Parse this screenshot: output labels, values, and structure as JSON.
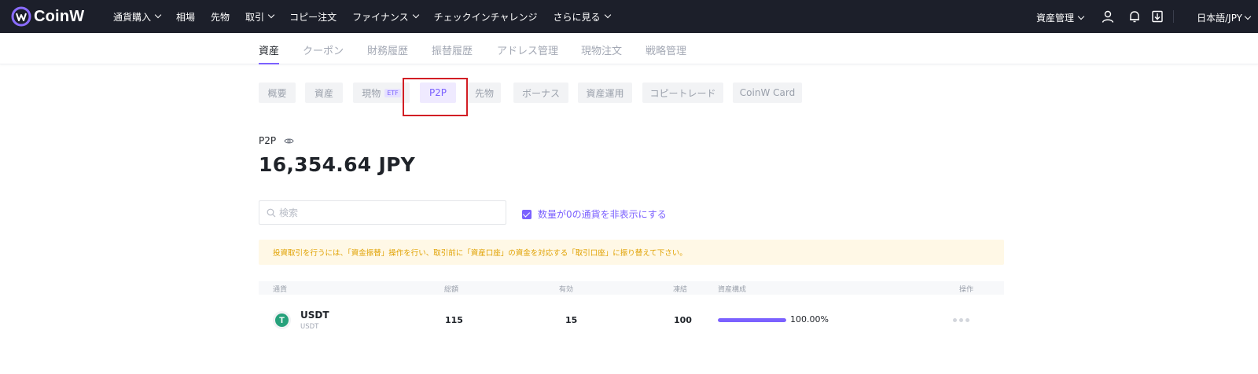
{
  "brand": {
    "name": "CoinW",
    "accent": "#7b61ff",
    "nav_bg": "#1c1f2a"
  },
  "topnav": {
    "items": [
      {
        "label": "通貨購入",
        "dropdown": true
      },
      {
        "label": "相場",
        "dropdown": false
      },
      {
        "label": "先物",
        "dropdown": false
      },
      {
        "label": "取引",
        "dropdown": true
      },
      {
        "label": "コピー注文",
        "dropdown": false
      },
      {
        "label": "ファイナンス",
        "dropdown": true
      },
      {
        "label": "チェックインチャレンジ",
        "dropdown": false
      },
      {
        "label": "さらに見る",
        "dropdown": true
      }
    ],
    "asset_management": "資産管理",
    "language": "日本語/JPY",
    "icons": [
      "user-icon",
      "bell-icon",
      "download-icon"
    ]
  },
  "subtabs": [
    {
      "label": "資産",
      "active": true
    },
    {
      "label": "クーポン",
      "active": false
    },
    {
      "label": "財務履歴",
      "active": false
    },
    {
      "label": "振替履歴",
      "active": false
    },
    {
      "label": "アドレス管理",
      "active": false
    },
    {
      "label": "現物注文",
      "active": false
    },
    {
      "label": "戦略管理",
      "active": false
    }
  ],
  "categories": [
    {
      "label": "概要"
    },
    {
      "label": "資産"
    },
    {
      "label": "現物",
      "badge": "ETF"
    },
    {
      "label": "P2P",
      "active": true
    },
    {
      "label": "先物"
    },
    {
      "label": "ボーナス"
    },
    {
      "label": "資産運用"
    },
    {
      "label": "コピートレード"
    },
    {
      "label": "CoinW Card"
    }
  ],
  "balance": {
    "label": "P2P",
    "value": "16,354.64 JPY"
  },
  "search": {
    "placeholder": "検索",
    "value": ""
  },
  "hide_zero": {
    "label": "数量が0の通貨を非表示にする",
    "checked": true
  },
  "notice": "投資取引を行うには、「資金振替」操作を行い、取引前に「資産口座」の資金を対応する「取引口座」に振り替えて下さい。",
  "table": {
    "headers": {
      "currency": "通貨",
      "total": "総額",
      "available": "有効",
      "frozen": "凍結",
      "composition": "資産構成",
      "action": "操作"
    },
    "rows": [
      {
        "symbol": "USDT",
        "sub": "USDT",
        "icon_glyph": "T",
        "total": "115",
        "available": "15",
        "frozen": "100",
        "composition_pct": "100.00%",
        "composition_fraction": 1.0
      }
    ]
  }
}
